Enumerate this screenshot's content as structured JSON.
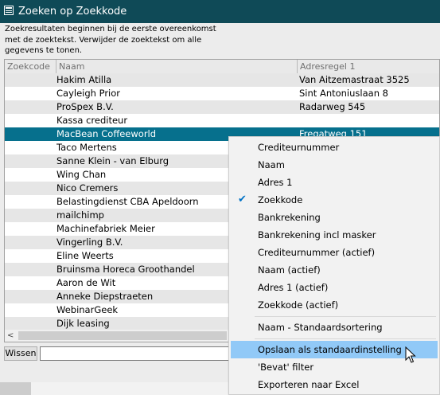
{
  "window": {
    "title": "Zoeken op Zoekkode",
    "icon": "app-window-icon"
  },
  "info_text": "Zoekresultaten beginnen bij de eerste overeenkomst met de zoektekst. Verwijder de zoektekst om alle gegevens te tonen.",
  "grid": {
    "columns": [
      "Zoekcode",
      "Naam",
      "Adresregel 1"
    ],
    "rows": [
      {
        "code": "",
        "naam": "Hakim Atilla",
        "adres": "Van Aitzemastraat 3525",
        "selected": false
      },
      {
        "code": "",
        "naam": "Cayleigh Prior",
        "adres": "Sint Antoniuslaan 8",
        "selected": false
      },
      {
        "code": "",
        "naam": "ProSpex B.V.",
        "adres": "Radarweg 545",
        "selected": false
      },
      {
        "code": "",
        "naam": "Kassa crediteur",
        "adres": "",
        "selected": false
      },
      {
        "code": "",
        "naam": "MacBean Coffeeworld",
        "adres": "Fregatweg 151",
        "selected": true
      },
      {
        "code": "",
        "naam": "Taco Mertens",
        "adres": "",
        "selected": false
      },
      {
        "code": "",
        "naam": "Sanne Klein - van Elburg",
        "adres": "",
        "selected": false
      },
      {
        "code": "",
        "naam": "Wing Chan",
        "adres": "",
        "selected": false
      },
      {
        "code": "",
        "naam": "Nico Cremers",
        "adres": "",
        "selected": false
      },
      {
        "code": "",
        "naam": "Belastingdienst CBA Apeldoorn",
        "adres": "",
        "selected": false
      },
      {
        "code": "",
        "naam": "mailchimp",
        "adres": "",
        "selected": false
      },
      {
        "code": "",
        "naam": "Machinefabriek Meier",
        "adres": "",
        "selected": false
      },
      {
        "code": "",
        "naam": "Vingerling B.V.",
        "adres": "",
        "selected": false
      },
      {
        "code": "",
        "naam": "Eline Weerts",
        "adres": "",
        "selected": false
      },
      {
        "code": "",
        "naam": "Bruinsma Horeca Groothandel",
        "adres": "",
        "selected": false
      },
      {
        "code": "",
        "naam": "Aaron de Wit",
        "adres": "",
        "selected": false
      },
      {
        "code": "",
        "naam": "Anneke Diepstraeten",
        "adres": "",
        "selected": false
      },
      {
        "code": "",
        "naam": "WebinarGeek",
        "adres": "",
        "selected": false
      },
      {
        "code": "",
        "naam": "Dijk leasing",
        "adres": "",
        "selected": false
      }
    ],
    "scroll_left_icon": "<"
  },
  "bottom": {
    "clear_label": "Wissen",
    "search_value": ""
  },
  "context_menu": {
    "items": [
      {
        "label": "Crediteurnummer",
        "checked": false,
        "hover": false
      },
      {
        "label": "Naam",
        "checked": false,
        "hover": false
      },
      {
        "label": "Adres 1",
        "checked": false,
        "hover": false
      },
      {
        "label": "Zoekkode",
        "checked": true,
        "hover": false
      },
      {
        "label": "Bankrekening",
        "checked": false,
        "hover": false
      },
      {
        "label": "Bankrekening incl masker",
        "checked": false,
        "hover": false
      },
      {
        "label": "Crediteurnummer (actief)",
        "checked": false,
        "hover": false
      },
      {
        "label": "Naam (actief)",
        "checked": false,
        "hover": false
      },
      {
        "label": "Adres 1 (actief)",
        "checked": false,
        "hover": false
      },
      {
        "label": "Zoekkode (actief)",
        "checked": false,
        "hover": false
      },
      {
        "separator": true
      },
      {
        "label": "Naam - Standaardsortering",
        "checked": false,
        "hover": false
      },
      {
        "separator": true
      },
      {
        "label": "Opslaan als standaardinstelling",
        "checked": false,
        "hover": true
      },
      {
        "label": "'Bevat' filter",
        "checked": false,
        "hover": false
      },
      {
        "label": "Exporteren naar Excel",
        "checked": false,
        "hover": false
      }
    ],
    "check_icon": "checkmark-icon"
  },
  "colors": {
    "titlebar": "#0f4a57",
    "selected_row": "#06708d",
    "menu_hover": "#91c9f7",
    "check": "#0072c6"
  }
}
